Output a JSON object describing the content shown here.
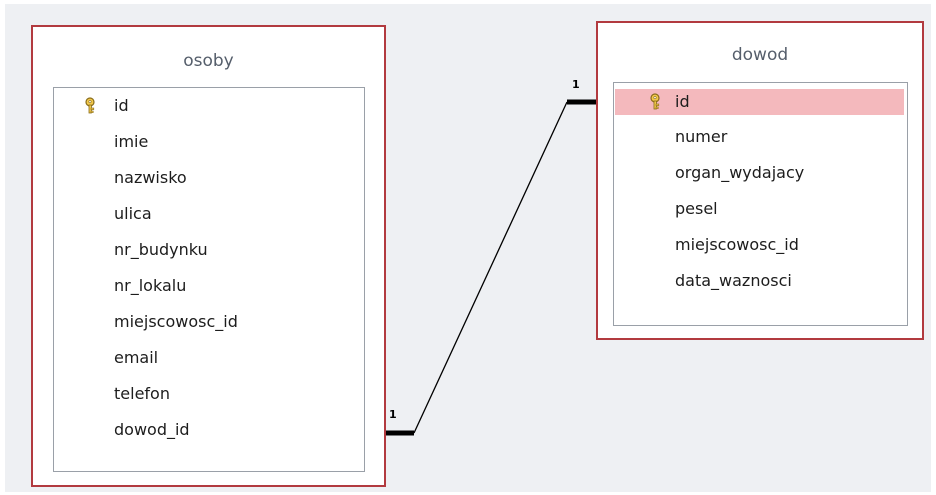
{
  "colors": {
    "table_border": "#b23a3f",
    "selected_row": "#f4b9bd",
    "canvas_bg": "#eef0f3",
    "line": "#000000"
  },
  "tables": [
    {
      "name": "osoby",
      "fields": [
        {
          "label": "id",
          "primary_key": true,
          "selected": false,
          "icon": "key-icon"
        },
        {
          "label": "imie"
        },
        {
          "label": "nazwisko"
        },
        {
          "label": "ulica"
        },
        {
          "label": "nr_budynku"
        },
        {
          "label": "nr_lokalu"
        },
        {
          "label": "miejscowosc_id"
        },
        {
          "label": "email"
        },
        {
          "label": "telefon"
        },
        {
          "label": "dowod_id"
        }
      ]
    },
    {
      "name": "dowod",
      "fields": [
        {
          "label": "id",
          "primary_key": true,
          "selected": true,
          "icon": "key-icon"
        },
        {
          "label": "numer"
        },
        {
          "label": "organ_wydajacy"
        },
        {
          "label": "pesel"
        },
        {
          "label": "miejscowosc_id"
        },
        {
          "label": "data_waznosci"
        }
      ]
    }
  ],
  "relationship": {
    "from": "osoby.dowod_id",
    "to": "dowod.id",
    "from_cardinality": "1",
    "to_cardinality": "1"
  }
}
